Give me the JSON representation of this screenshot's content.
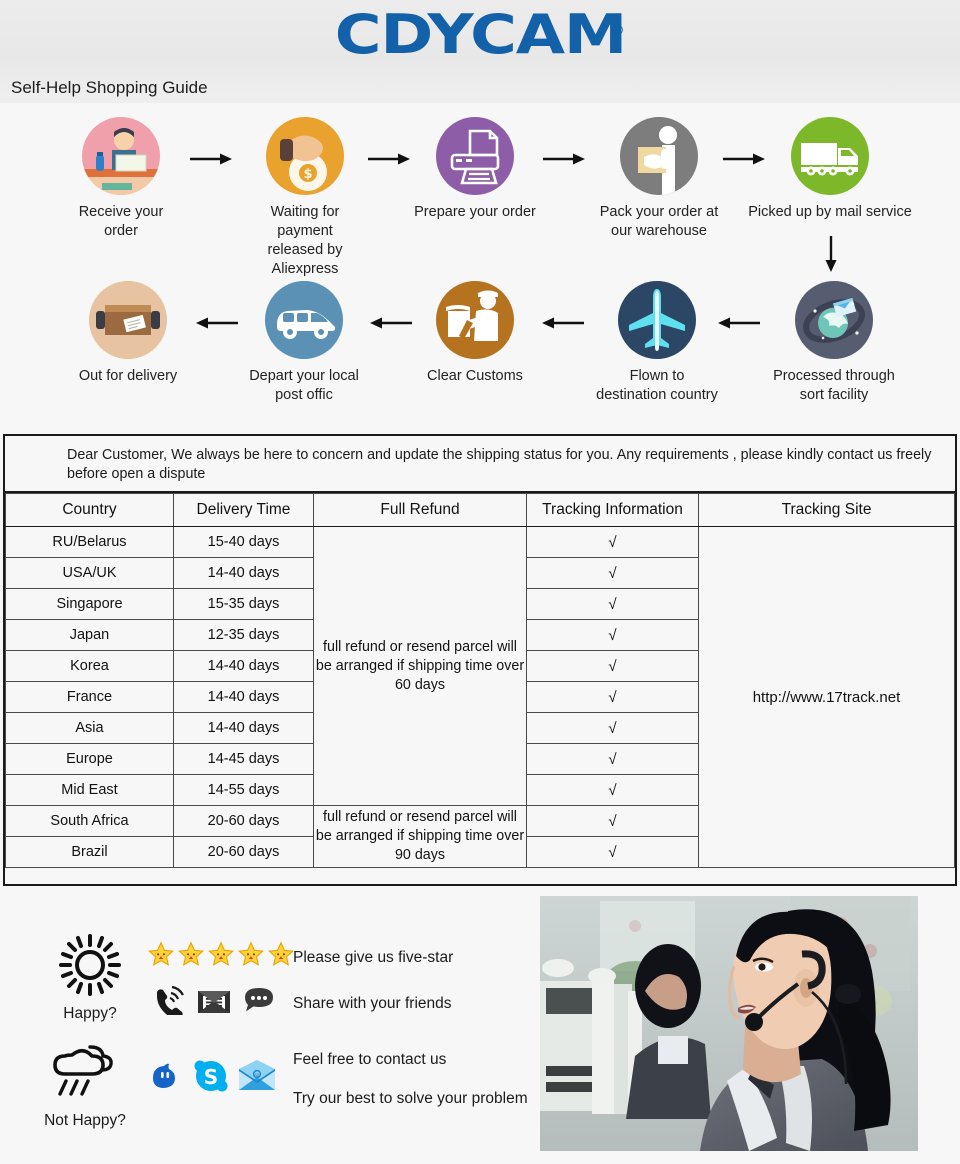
{
  "header": {
    "brand": "CDYCAM",
    "brand_mark": "®",
    "brand_color": "#1361a8",
    "page_title": "Self-Help Shopping Guide"
  },
  "flow": {
    "row1": [
      {
        "label": "Receive your order",
        "icon": "person-at-desk-icon",
        "color": "#f0a0ab"
      },
      {
        "label": "Waiting for payment\nreleased by Aliexpress",
        "icon": "hand-money-bag-icon",
        "color": "#e9a22d"
      },
      {
        "label": "Prepare your order",
        "icon": "printer-icon",
        "color": "#8e5da7"
      },
      {
        "label": "Pack your order at\nour warehouse",
        "icon": "worker-with-box-icon",
        "color": "#7d7d7d"
      },
      {
        "label": "Picked up by mail service",
        "icon": "delivery-truck-icon",
        "color": "#7db82a"
      }
    ],
    "row2": [
      {
        "label": "Out for delivery",
        "icon": "parcel-box-icon",
        "color": "#e8c3a1"
      },
      {
        "label": "Depart your local\npost offic",
        "icon": "delivery-van-icon",
        "color": "#5a91b4"
      },
      {
        "label": "Clear  Customs",
        "icon": "customs-officer-icon",
        "color": "#b5731f"
      },
      {
        "label": "Flown to\ndestination country",
        "icon": "airplane-icon",
        "color": "#2c4766"
      },
      {
        "label": "Processed through\nsort facility",
        "icon": "global-sort-icon",
        "color": "#575d70"
      }
    ],
    "arrows": {
      "right": "arrow-right-icon",
      "left": "arrow-left-icon",
      "down": "arrow-down-icon"
    }
  },
  "shipping": {
    "notice": "Dear Customer, We always be here to concern and update the shipping status for you.  Any requirements , please kindly contact us freely before open a dispute",
    "columns": [
      "Country",
      "Delivery Time",
      "Full Refund",
      "Tracking Information",
      "Tracking Site"
    ],
    "rows": [
      {
        "country": "RU/Belarus",
        "delivery": "15-40 days",
        "tracking": "√"
      },
      {
        "country": "USA/UK",
        "delivery": "14-40 days",
        "tracking": "√"
      },
      {
        "country": "Singapore",
        "delivery": "15-35 days",
        "tracking": "√"
      },
      {
        "country": "Japan",
        "delivery": "12-35 days",
        "tracking": "√"
      },
      {
        "country": "Korea",
        "delivery": "14-40 days",
        "tracking": "√"
      },
      {
        "country": "France",
        "delivery": "14-40 days",
        "tracking": "√"
      },
      {
        "country": "Asia",
        "delivery": "14-40 days",
        "tracking": "√"
      },
      {
        "country": "Europe",
        "delivery": "14-45 days",
        "tracking": "√"
      },
      {
        "country": "Mid East",
        "delivery": "14-55 days",
        "tracking": "√"
      },
      {
        "country": "South Africa",
        "delivery": "20-60 days",
        "tracking": "√"
      },
      {
        "country": "Brazil",
        "delivery": "20-60 days",
        "tracking": "√"
      }
    ],
    "refund_60": "full refund or resend parcel will be arranged if shipping time over 60 days",
    "refund_90": "full refund or resend parcel will be arranged if shipping time over 90 days",
    "tracking_site": "http://www.17track.net"
  },
  "feedback": {
    "happy_label": "Happy?",
    "not_happy_label": "Not Happy?",
    "happy_icon": "sun-icon",
    "not_happy_icon": "rain-cloud-icon",
    "star_count": 5,
    "star_icon": "star-icon",
    "five_star_text": "Please give us five-star",
    "share_text": "Share with your friends",
    "share_icons": [
      "phone-ringing-icon",
      "envelope-icon",
      "speech-bubble-icon"
    ],
    "contact_text": "Feel free to contact us",
    "solve_text": "Try our best to solve your problem",
    "contact_icons": [
      "trade-manager-icon",
      "skype-icon",
      "mail-envelope-icon"
    ],
    "photo": "call-center-agent-photo"
  }
}
